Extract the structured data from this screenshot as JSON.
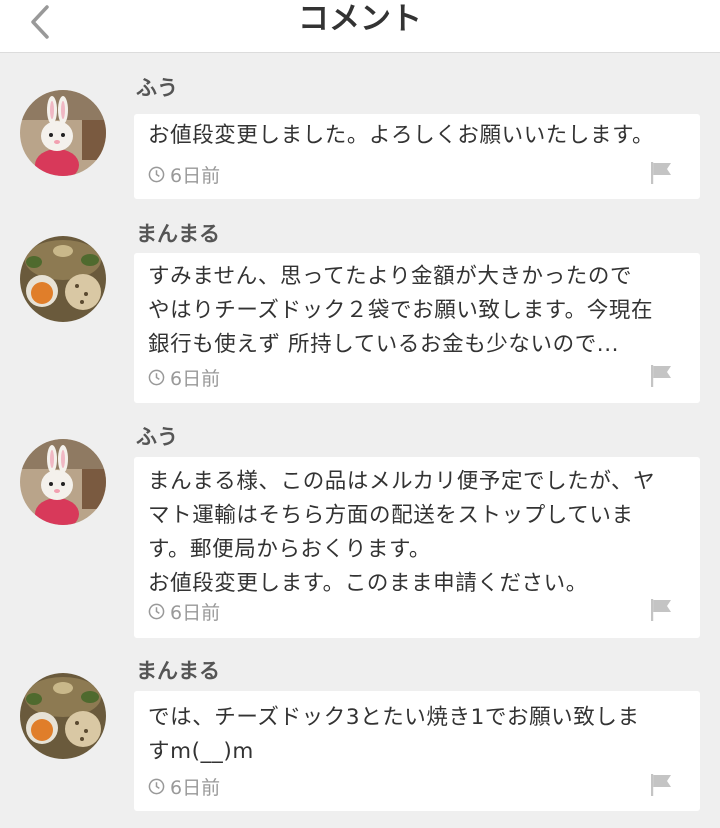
{
  "header": {
    "title": "コメント",
    "back_icon": "chevron-left-icon"
  },
  "comments": [
    {
      "user": "ふう",
      "avatar": "rabbit-avatar",
      "text": "お値段変更しました。よろしくお願いいたします。",
      "time": "6日前"
    },
    {
      "user": "まんまる",
      "avatar": "food-avatar",
      "text": "すみません、思ってたより金額が大きかったので\nやはりチーズドック２袋でお願い致します。今現在\n銀行も使えず 所持しているお金も少ないので...",
      "time": "6日前"
    },
    {
      "user": "ふう",
      "avatar": "rabbit-avatar",
      "text": "まんまる様、この品はメルカリ便予定でしたが、ヤ\nマト運輸はそちら方面の配送をストップしていま\nす。郵便局からおくります。\nお値段変更します。このまま申請ください。",
      "time": "6日前"
    },
    {
      "user": "まんまる",
      "avatar": "food-avatar",
      "text": "では、チーズドック3とたい焼き1でお願い致しま\nすm(__)m",
      "time": "6日前"
    }
  ]
}
